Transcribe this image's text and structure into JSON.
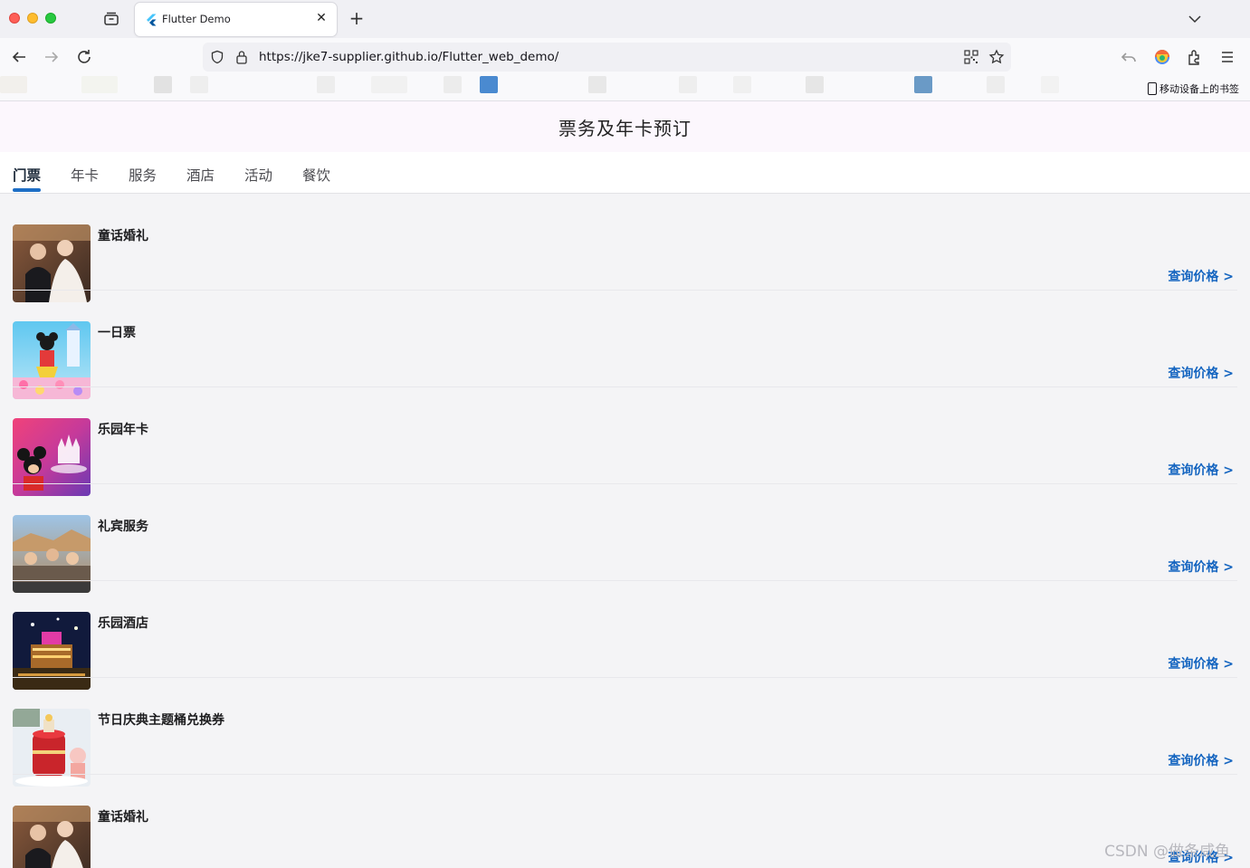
{
  "browser": {
    "tab_title": "Flutter Demo",
    "url": "https://jke7-supplier.github.io/Flutter_web_demo/",
    "mobile_bookmarks_label": "移动设备上的书签"
  },
  "app": {
    "title": "票务及年卡预订",
    "tabs": [
      "门票",
      "年卡",
      "服务",
      "酒店",
      "活动",
      "餐饮"
    ],
    "active_tab": "门票",
    "items": [
      {
        "title": "童话婚礼",
        "action": "查询价格 >"
      },
      {
        "title": "一日票",
        "action": "查询价格 >"
      },
      {
        "title": "乐园年卡",
        "action": "查询价格 >"
      },
      {
        "title": "礼宾服务",
        "action": "查询价格 >"
      },
      {
        "title": "乐园酒店",
        "action": "查询价格 >"
      },
      {
        "title": "节日庆典主题桶兑换券",
        "action": "查询价格 >"
      },
      {
        "title": "童话婚礼",
        "action": "查询价格 >"
      }
    ]
  },
  "watermark": "CSDN @做条咸鱼",
  "colors": {
    "accent": "#1565c0",
    "tab_indicator": "#1d6ec5",
    "appbar_bg": "#fcf7fd",
    "list_bg": "#f4f4f6"
  }
}
